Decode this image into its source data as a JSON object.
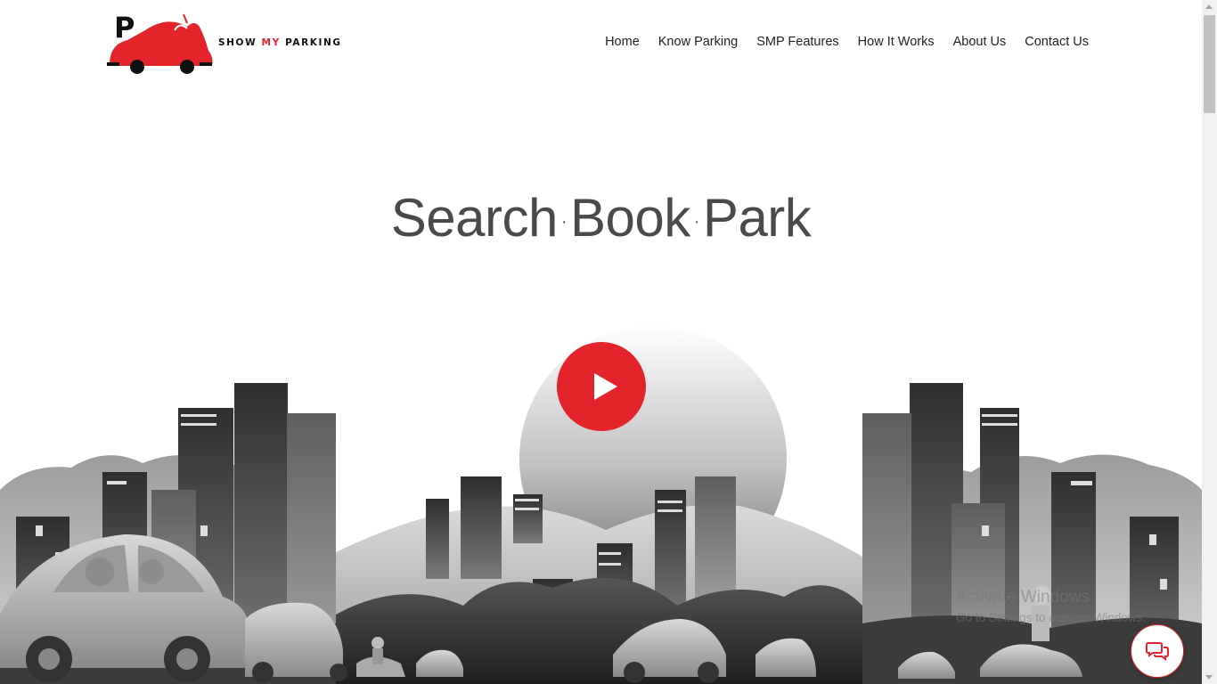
{
  "brand": {
    "letter": "P",
    "name_part1": "SHOW",
    "name_part2": "MY",
    "name_part3": "PARKING"
  },
  "nav": {
    "items": [
      {
        "label": "Home"
      },
      {
        "label": "Know Parking"
      },
      {
        "label": "SMP Features"
      },
      {
        "label": "How It Works"
      },
      {
        "label": "About Us"
      },
      {
        "label": "Contact Us"
      }
    ]
  },
  "hero": {
    "word1": "Search",
    "word2": "Book",
    "word3": "Park",
    "separator": "·"
  },
  "watermark": {
    "line1": "Activate Windows",
    "line2": "Go to Settings to activate Windows."
  },
  "colors": {
    "accent": "#e3242b",
    "text": "#222222",
    "hero_text": "#4a4a4a"
  },
  "icons": {
    "play": "play-icon",
    "chat": "chat-bubbles-icon"
  }
}
